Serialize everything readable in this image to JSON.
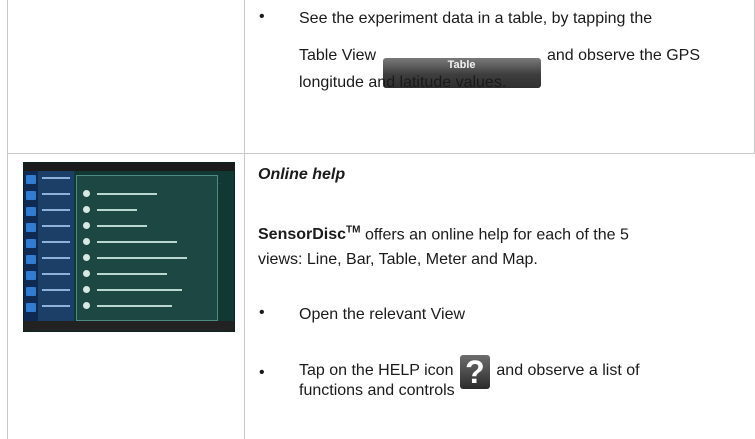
{
  "row1": {
    "bullet_text_a": "See the experiment data in a table, by tapping the",
    "bullet_text_b_pre": "Table View",
    "table_button_label": "Table",
    "bullet_text_b_post": "and observe the GPS",
    "bullet_text_c": "longitude and latitude values."
  },
  "row2": {
    "heading": "Online help",
    "brand": "SensorDisc",
    "brand_tm": "TM",
    "para_a_rest": " offers an online help for each of the 5",
    "para_b": "views: Line, Bar, Table, Meter and Map.",
    "bullet1": "Open the relevant View",
    "bullet2_pre": "Tap on the HELP icon",
    "help_icon_glyph": "?",
    "bullet2_post": "and observe a list of",
    "bullet2_cont": "functions and controls"
  },
  "icons": {
    "help": "help-question-icon",
    "table_button": "table-view-button"
  },
  "colors": {
    "grid": "#c8c8c8",
    "button_dark": "#3e3e3e",
    "thumbnail_bg": "#123834"
  }
}
